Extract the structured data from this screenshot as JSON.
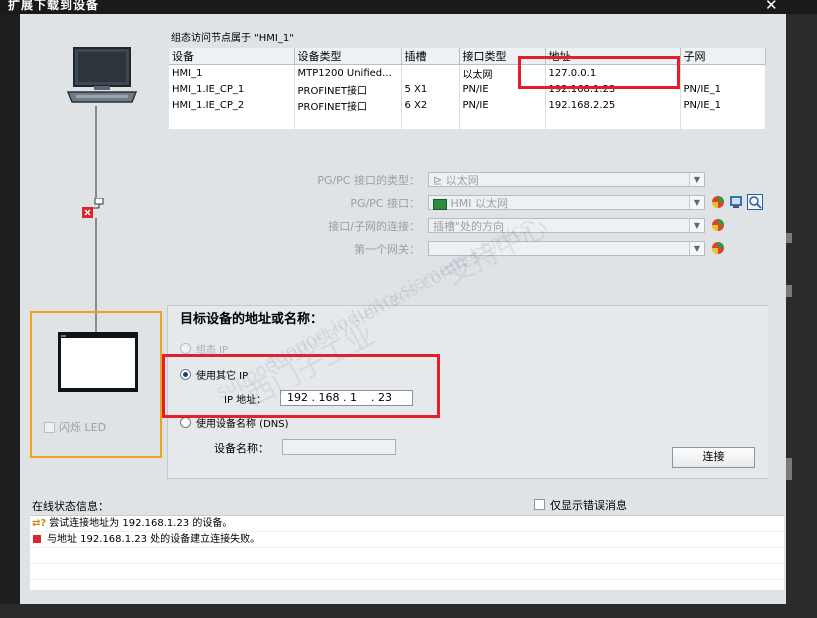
{
  "window": {
    "title": "扩展下载到设备",
    "close_label": "✕"
  },
  "config": {
    "label": "组态访问节点属于 \"HMI_1\"",
    "columns": [
      "设备",
      "设备类型",
      "插槽",
      "接口类型",
      "地址",
      "子网"
    ],
    "rows": [
      [
        "HMI_1",
        "MTP1200 Unified...",
        "",
        "以太网",
        "127.0.0.1",
        ""
      ],
      [
        "HMI_1.IE_CP_1",
        "PROFINET接口",
        "5 X1",
        "PN/IE",
        "192.168.1.23",
        "PN/IE_1"
      ],
      [
        "HMI_1.IE_CP_2",
        "PROFINET接口",
        "6 X2",
        "PN/IE",
        "192.168.2.25",
        "PN/IE_1"
      ]
    ]
  },
  "interface": {
    "type_label": "PG/PC 接口的类型：",
    "type_value": "以太网",
    "pgpc_label": "PG/PC 接口：",
    "pgpc_value": "HMI 以太网",
    "conn_label": "接口/子网的连接：",
    "conn_value": "插槽\"处的方向",
    "gateway_label": "第一个网关：",
    "gateway_value": ""
  },
  "target": {
    "heading": "目标设备的地址或名称：",
    "opt_config_ip": "组态 IP",
    "opt_other_ip": "使用其它 IP",
    "ip_label": "IP 地址：",
    "ip_value": "192 . 168 . 1    . 23",
    "opt_dns": "使用设备名称 (DNS)",
    "devname_label": "设备名称：",
    "devname_value": "",
    "connect_button": "连接"
  },
  "flash_led": "闪烁 LED",
  "status": {
    "label": "在线状态信息：",
    "errors_only": "仅显示错误消息",
    "messages": [
      "尝试连接地址为 192.168.1.23 的设备。",
      "与地址 192.168.1.23 处的设备建立连接失败。"
    ]
  },
  "watermark": {
    "lines": [
      "西门子工业",
      "支持中心",
      "support.industry.siemens.com/cs",
      "support.industry.siemens.com/cs"
    ]
  },
  "colors": {
    "highlight_red": "#e51e2b",
    "highlight_orange": "#f0a21b",
    "selected_radio": "#1b3f8a"
  }
}
